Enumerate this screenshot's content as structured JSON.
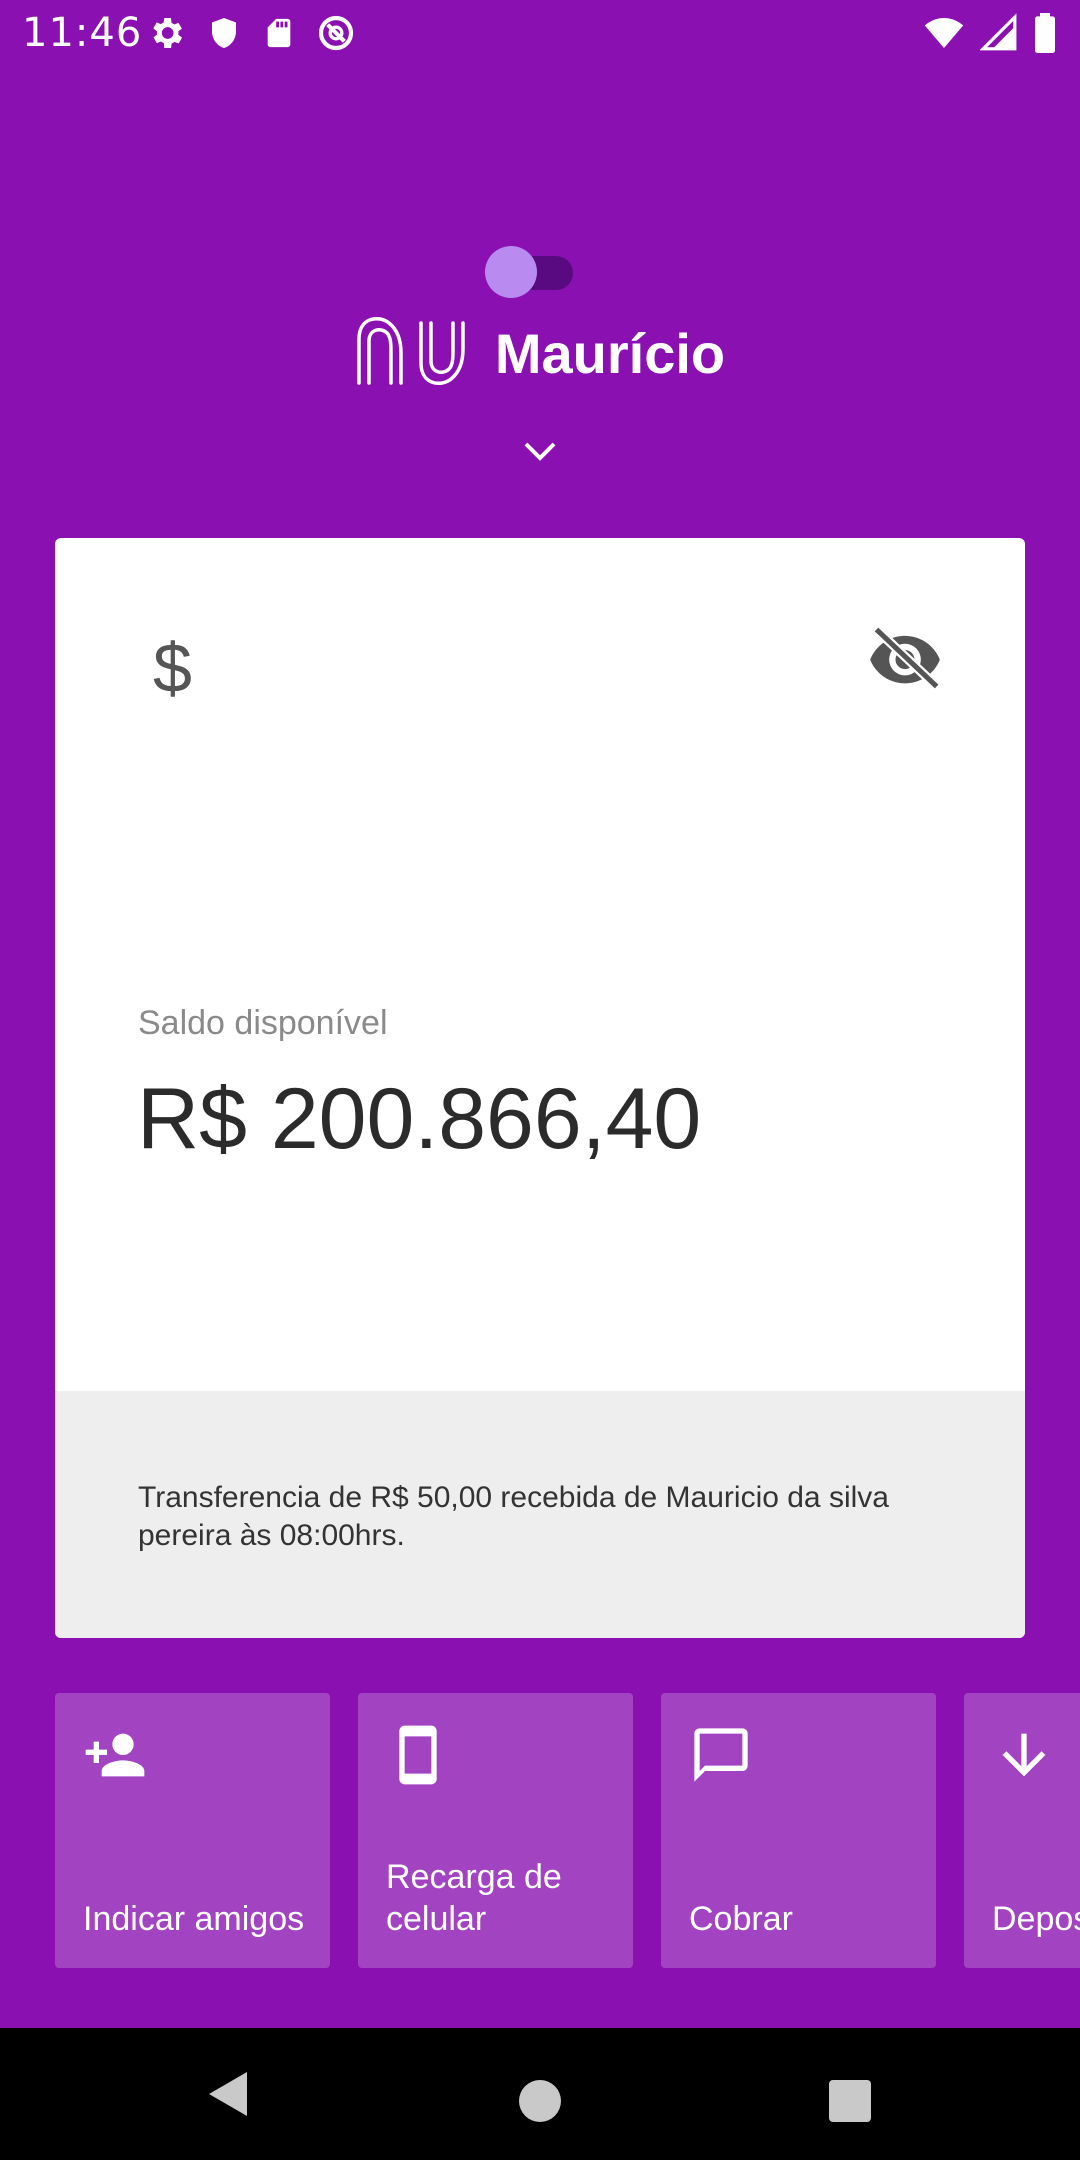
{
  "status_bar": {
    "time": "11:46",
    "icons_left": [
      "settings-icon",
      "shield-icon",
      "sd-card-icon",
      "data-saver-icon"
    ],
    "icons_right": [
      "wifi-icon",
      "signal-icon",
      "battery-icon"
    ]
  },
  "header": {
    "user_name": "Maurício",
    "logo": "nu-logo",
    "toggle_state": "off",
    "chevron": "chevron-down-icon"
  },
  "balance_card": {
    "currency_icon_text": "$",
    "visibility_icon": "eye-off-icon",
    "label": "Saldo disponível",
    "value": "R$ 200.866,40",
    "notification": "Transferencia de R$ 50,00 recebida de Mauricio da silva pereira às 08:00hrs."
  },
  "shortcuts": [
    {
      "label": "Indicar amigos",
      "icon": "add-person-icon"
    },
    {
      "label": "Recarga de celular",
      "icon": "smartphone-icon"
    },
    {
      "label": "Cobrar",
      "icon": "chat-icon"
    },
    {
      "label": "Depositar",
      "icon": "arrow-down-icon"
    }
  ],
  "colors": {
    "background": "#8a10b1",
    "shortcut_tile": "#a244c2",
    "card": "#ffffff",
    "card_footer": "#eeeeee"
  }
}
